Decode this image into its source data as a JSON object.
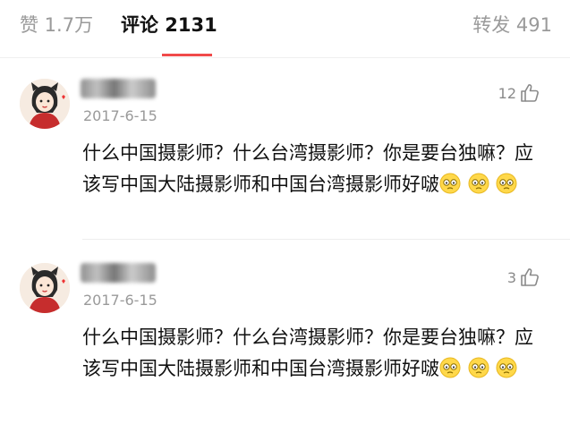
{
  "tabs": {
    "likes": "赞 1.7万",
    "comments": "评论 2131",
    "reposts": "转发 491"
  },
  "colors": {
    "accent": "#f04a4a",
    "muted": "#9a9a9a"
  },
  "comments": [
    {
      "date": "2017-6-15",
      "likes": "12",
      "text": "什么中国摄影师？什么台湾摄影师？你是要台独嘛？应该写中国大陆摄影师和中国台湾摄影师好啵",
      "emoji": [
        "facepalm-emoji",
        "facepalm-emoji",
        "facepalm-emoji"
      ]
    },
    {
      "date": "2017-6-15",
      "likes": "3",
      "text": "什么中国摄影师？什么台湾摄影师？你是要台独嘛？应该写中国大陆摄影师和中国台湾摄影师好啵",
      "emoji": [
        "facepalm-emoji",
        "facepalm-emoji",
        "facepalm-emoji"
      ]
    }
  ]
}
